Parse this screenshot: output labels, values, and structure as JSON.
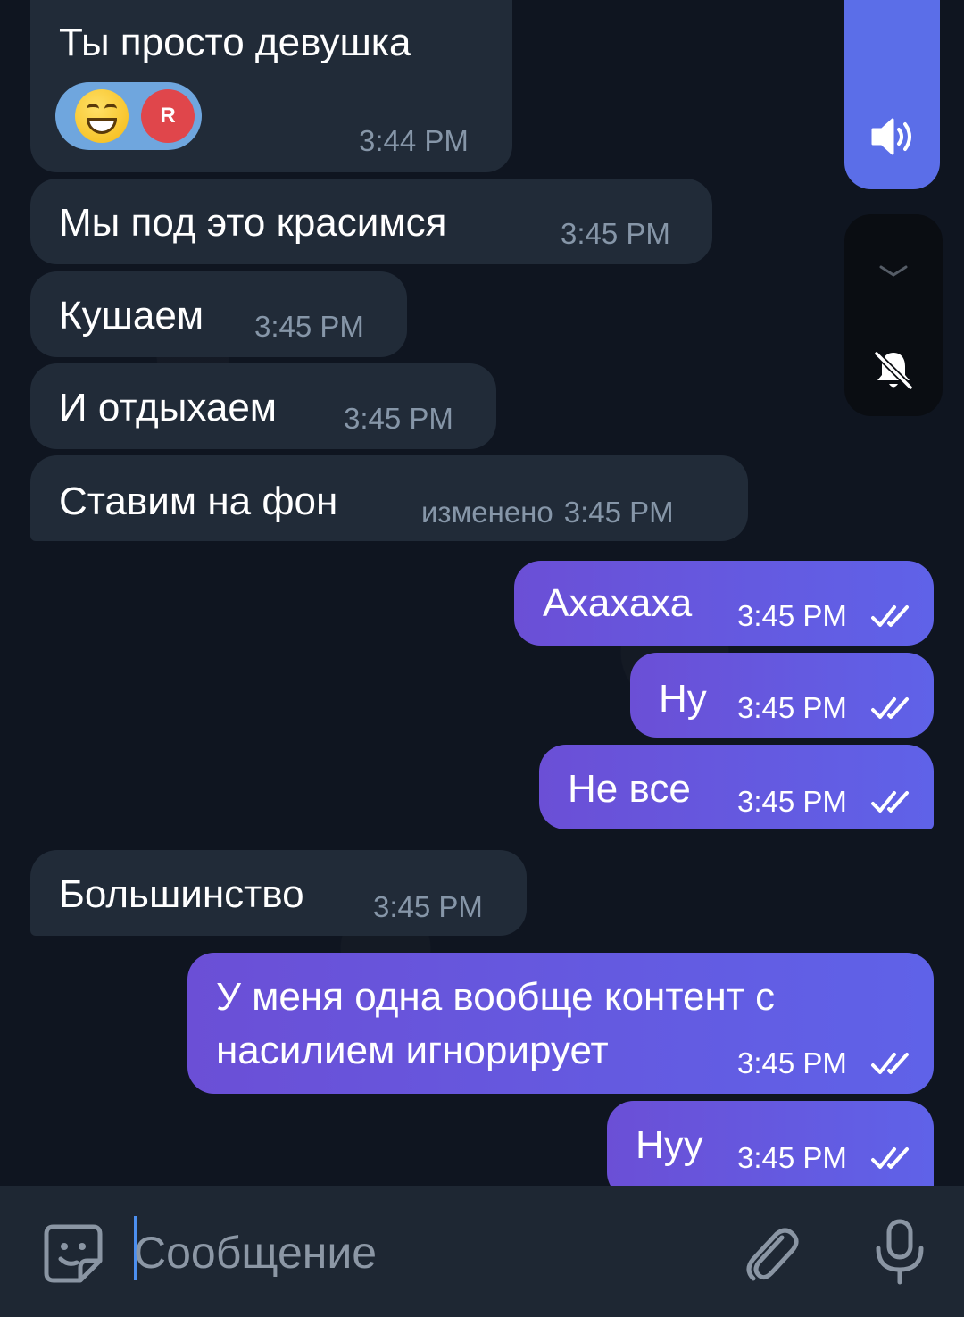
{
  "messages": [
    {
      "text": "Ты просто девушка",
      "time": "3:44 PM",
      "reaction": {
        "emoji": "grinning-face",
        "user_initial": "R"
      }
    },
    {
      "text": "Мы под это красимся",
      "time": "3:45 PM"
    },
    {
      "text": "Кушаем",
      "time": "3:45 PM"
    },
    {
      "text": "И отдыхаем",
      "time": "3:45 PM"
    },
    {
      "text": "Ставим на фон",
      "edited": "изменено",
      "time": "3:45 PM"
    },
    {
      "text": "Ахахаха",
      "time": "3:45 PM"
    },
    {
      "text": "Ну",
      "time": "3:45 PM"
    },
    {
      "text": "Не все",
      "time": "3:45 PM"
    },
    {
      "text": "Большинство",
      "time": "3:45 PM"
    },
    {
      "text_line1": "У меня одна вообще контент с",
      "text_line2": "насилием игнорирует",
      "time": "3:45 PM"
    },
    {
      "text": "Нуу",
      "time": "3:45 PM"
    }
  ],
  "input": {
    "placeholder": "Сообщение"
  },
  "icons": {
    "sticker": "sticker-icon",
    "attach": "paperclip-icon",
    "mic": "microphone-icon",
    "volume": "speaker-icon",
    "chevron": "chevron-down-icon",
    "mute": "bell-off-icon",
    "read": "double-check-icon"
  },
  "colors": {
    "background": "#0f1520",
    "incoming_bubble": "#212b38",
    "outgoing_bubble": "#6b4fd6",
    "outgoing_bubble_end": "#5f62e8",
    "incoming_time": "#8696a8",
    "side_panel": "#5b6ee8",
    "input_bar": "#1e2733",
    "cursor": "#4c8ff0"
  }
}
